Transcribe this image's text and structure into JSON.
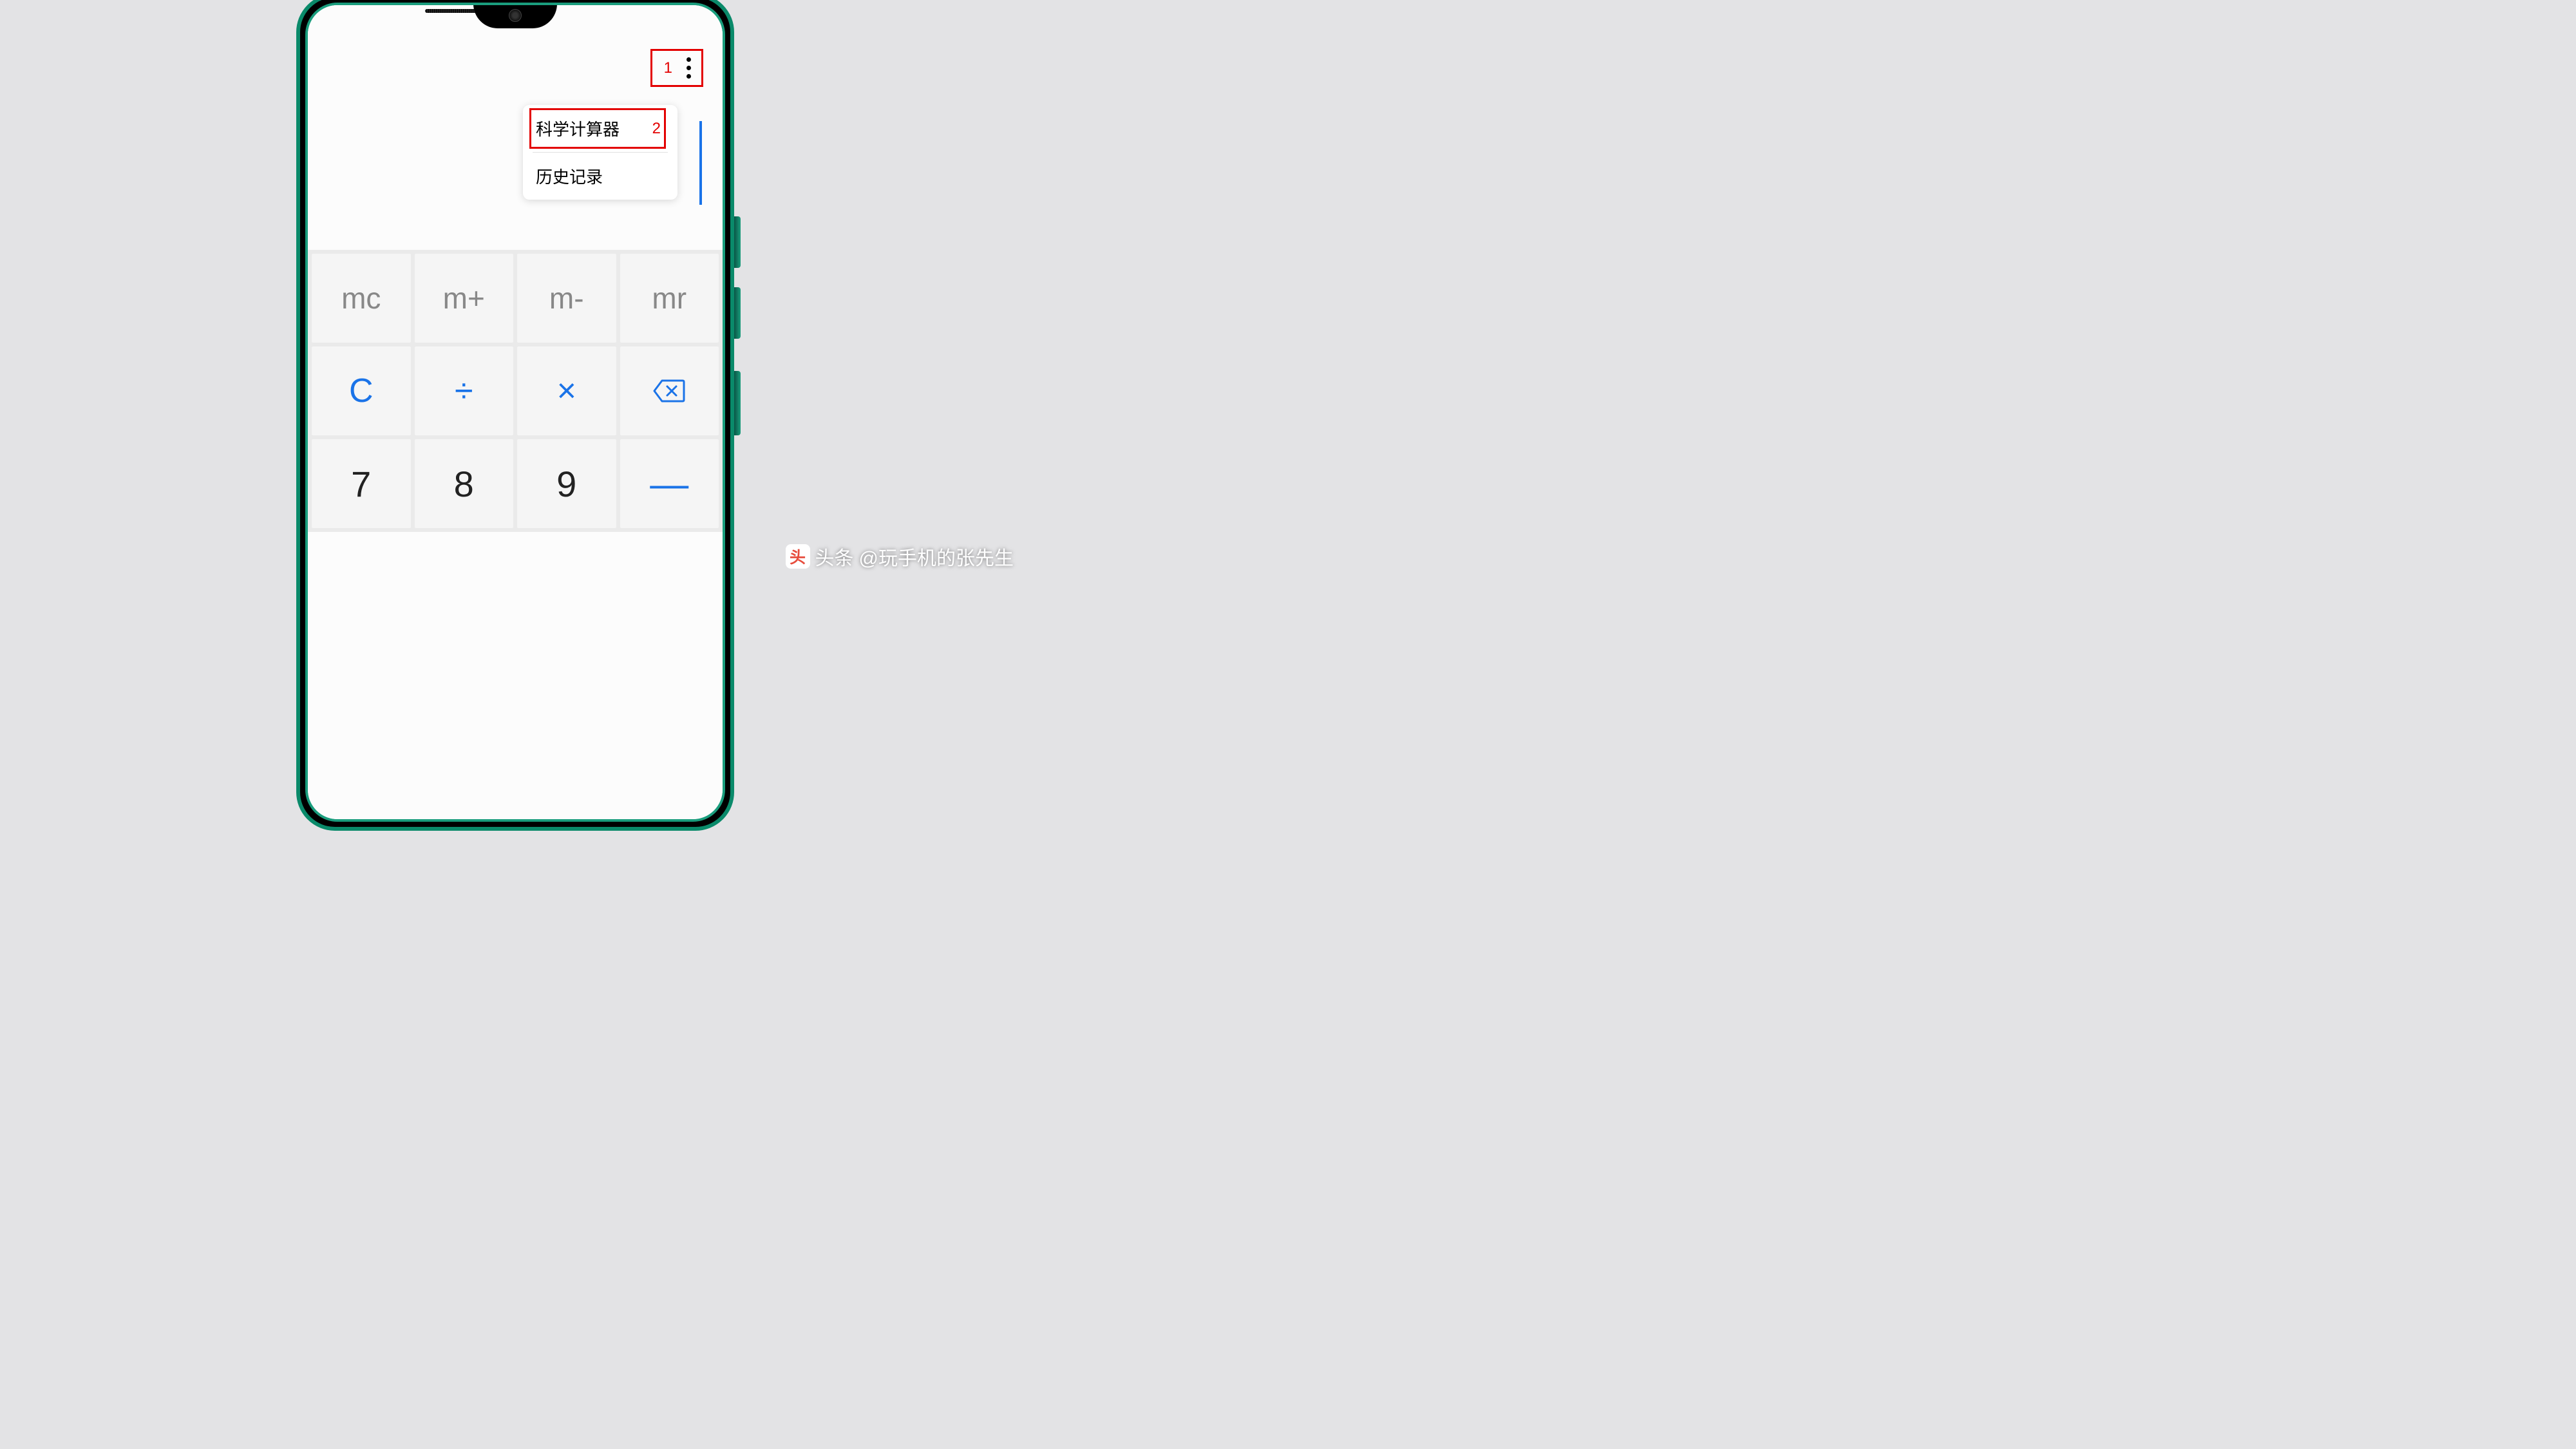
{
  "annotations": {
    "marker_1": "1",
    "marker_2": "2"
  },
  "menu": {
    "item_scientific": "科学计算器",
    "item_history": "历史记录"
  },
  "keypad": {
    "mc": "mc",
    "m_plus": "m+",
    "m_minus": "m-",
    "mr": "mr",
    "clear": "C",
    "divide": "÷",
    "multiply": "×",
    "seven": "7",
    "eight": "8",
    "nine": "9",
    "minus": "—"
  },
  "watermark": {
    "icon_text": "头",
    "label": "头条",
    "author": "@玩手机的张先生"
  }
}
